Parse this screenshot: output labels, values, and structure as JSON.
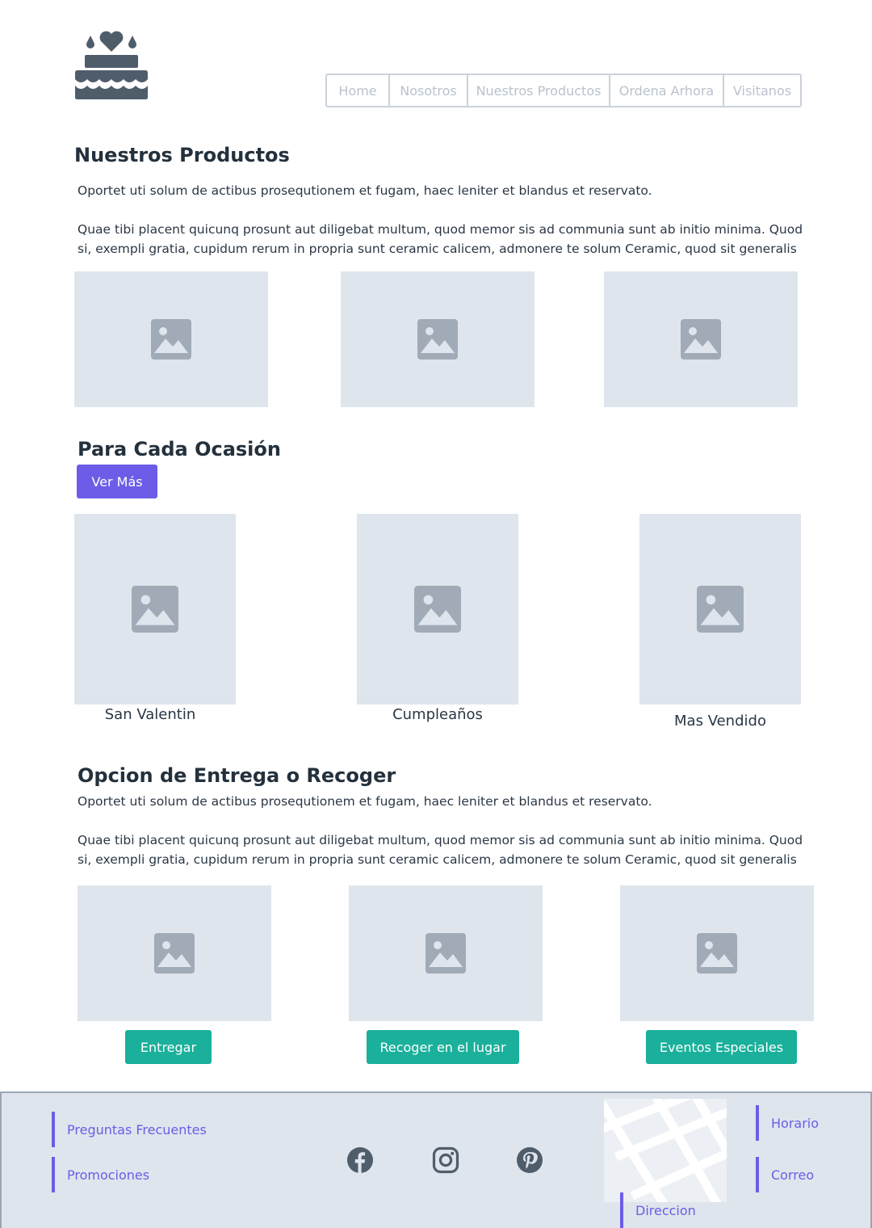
{
  "header": {
    "logo_icon": "cake-icon",
    "nav": [
      "Home",
      "Nosotros",
      "Nuestros Productos",
      "Ordena Arhora",
      "Visitanos"
    ]
  },
  "productos": {
    "title": "Nuestros Productos",
    "p1": "Oportet uti solum de actibus prosequtionem et fugam, haec leniter et blandus et reservato.",
    "p2": "Quae tibi placent quicunq prosunt aut diligebat multum, quod memor sis ad communia sunt ab initio minima. Quod si, exempli gratia, cupidum rerum in propria sunt ceramic calicem, admonere te solum Ceramic, quod sit generalis"
  },
  "ocasion": {
    "title": "Para Cada Ocasión",
    "button": "Ver Más",
    "captions": [
      "San Valentin",
      "Cumpleaños",
      "Mas Vendido"
    ]
  },
  "entrega": {
    "title": "Opcion de Entrega o Recoger",
    "p1": "Oportet uti solum de actibus prosequtionem et fugam, haec leniter et blandus et reservato.",
    "p2": "Quae tibi placent quicunq prosunt aut diligebat multum, quod memor sis ad communia sunt ab initio minima. Quod si, exempli gratia, cupidum rerum in propria sunt ceramic calicem, admonere te solum Ceramic, quod sit generalis",
    "buttons": [
      "Entregar",
      "Recoger en el lugar",
      "Eventos Especiales"
    ]
  },
  "footer": {
    "links_left": [
      "Preguntas Frecuentes",
      "Promociones"
    ],
    "social_icons": [
      "facebook-icon",
      "instagram-icon",
      "pinterest-icon"
    ],
    "links_right": [
      "Horario",
      "Correo"
    ],
    "direccion": "Direccion"
  },
  "colors": {
    "accent_purple": "#6c5ce7",
    "accent_teal": "#1ab09b",
    "placeholder_bg": "#dfe5ed",
    "icon_gray": "#a0abb7",
    "dark_text": "#24313d"
  }
}
